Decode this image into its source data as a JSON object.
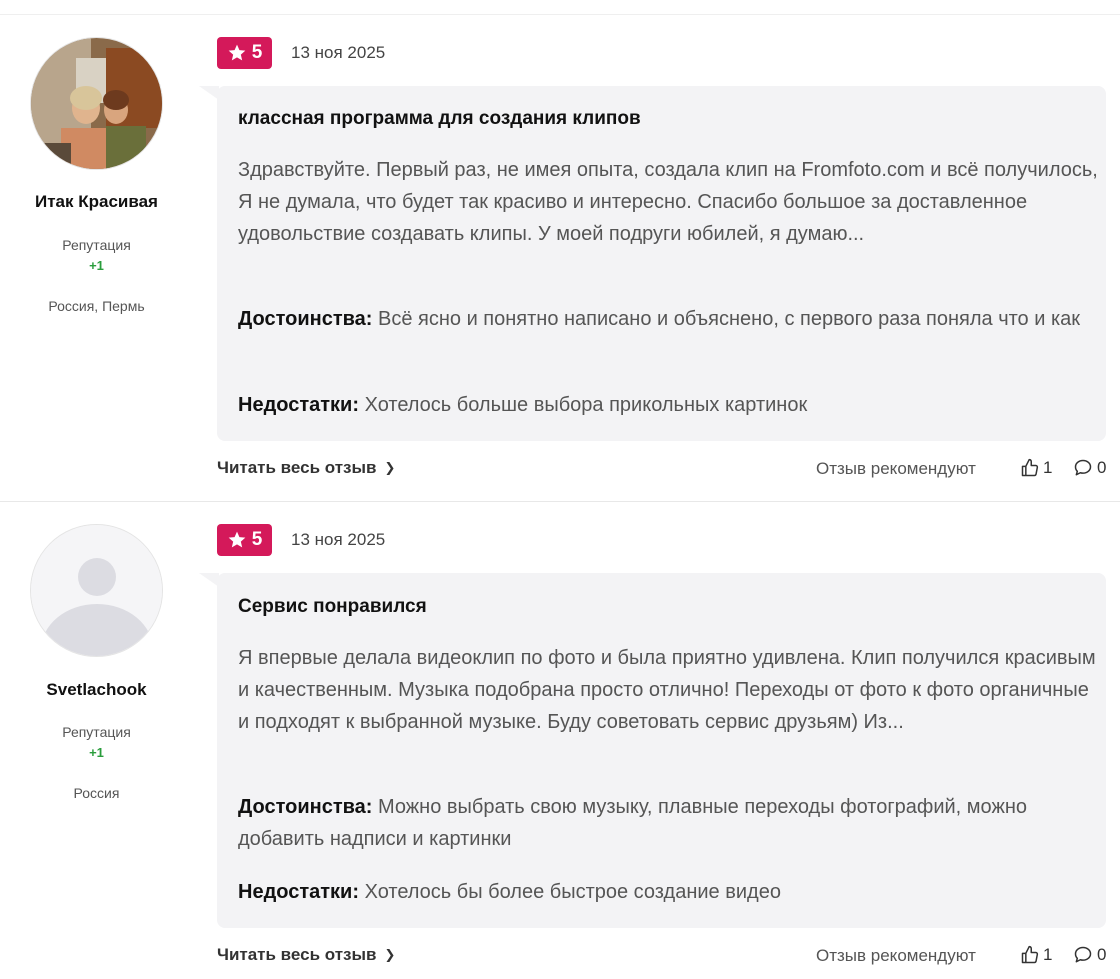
{
  "reviews": [
    {
      "author": {
        "name": "Итак Красивая",
        "reputation_label": "Репутация",
        "reputation_value": "+1",
        "location": "Россия, Пермь"
      },
      "rating": "5",
      "date": "13 ноя 2025",
      "title": "классная программа для создания клипов",
      "text": "Здравствуйте. Первый раз, не имея опыта, создала клип на Fromfoto.com и всё получилось, Я не думала, что будет так красиво и интересно. Спасибо большое за доставленное удовольствие создавать клипы. У моей подруги юбилей, я думаю...",
      "pros_label": "Достоинства:",
      "pros": "Всё ясно и понятно написано и объяснено, с первого раза поняла что и как",
      "cons_label": "Недостатки:",
      "cons": "Хотелось больше выбора прикольных картинок",
      "read_more": "Читать весь отзыв",
      "recommend_label": "Отзыв рекомендуют",
      "likes": "1",
      "comments": "0"
    },
    {
      "author": {
        "name": "Svetlachook",
        "reputation_label": "Репутация",
        "reputation_value": "+1",
        "location": "Россия"
      },
      "rating": "5",
      "date": "13 ноя 2025",
      "title": "Сервис понравился",
      "text": "Я впервые делала видеоклип по фото и была приятно удивлена. Клип получился красивым и качественным. Музыка подобрана просто отлично! Переходы от фото к фото органичные и подходят к выбранной музыке. Буду советовать сервис друзьям) Из...",
      "pros_label": "Достоинства:",
      "pros": "Можно выбрать свою музыку, плавные переходы фотографий, можно добавить надписи и картинки",
      "cons_label": "Недостатки:",
      "cons": "Хотелось бы более быстрое создание видео",
      "read_more": "Читать весь отзыв",
      "recommend_label": "Отзыв рекомендуют",
      "likes": "1",
      "comments": "0"
    }
  ],
  "icons": {
    "star": "star-icon",
    "chevron": "chevron-right-icon",
    "like": "thumbs-up-icon",
    "comment": "comment-icon"
  },
  "colors": {
    "rating_badge": "#d4195a",
    "reputation_positive": "#2a9d3c",
    "bubble_bg": "#f3f3f5"
  }
}
